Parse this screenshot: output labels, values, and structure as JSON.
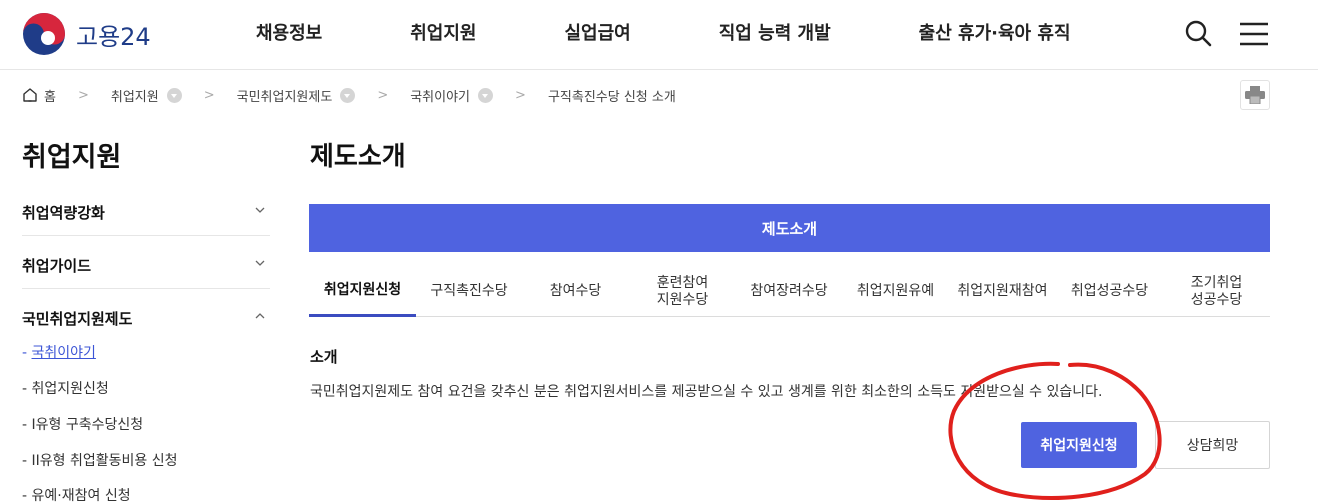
{
  "header": {
    "logo_text": "고용24",
    "nav": [
      "채용정보",
      "취업지원",
      "실업급여",
      "직업 능력 개발",
      "출산 휴가·육아 휴직"
    ]
  },
  "breadcrumb": {
    "home": "홈",
    "items": [
      "취업지원",
      "국민취업지원제도",
      "국취이야기",
      "구직촉진수당 신청 소개"
    ]
  },
  "sidebar": {
    "title": "취업지원",
    "sections": [
      "취업역량강화",
      "취업가이드",
      "국민취업지원제도"
    ],
    "sub_items": [
      {
        "label": "국취이야기",
        "active": true
      },
      {
        "label": "취업지원신청",
        "active": false
      },
      {
        "label": "I유형 구축수당신청",
        "active": false
      },
      {
        "label": "II유형 취업활동비용 신청",
        "active": false
      },
      {
        "label": "유예·재참여 신청",
        "active": false
      }
    ],
    "sub_prefix": "- "
  },
  "main": {
    "title": "제도소개",
    "banner": "제도소개",
    "tabs": [
      {
        "label": "취업지원신청",
        "active": true
      },
      {
        "label": "구직촉진수당",
        "active": false
      },
      {
        "label": "참여수당",
        "active": false
      },
      {
        "label": "훈련참여\n지원수당",
        "active": false
      },
      {
        "label": "참여장려수당",
        "active": false
      },
      {
        "label": "취업지원유예",
        "active": false
      },
      {
        "label": "취업지원재참여",
        "active": false
      },
      {
        "label": "취업성공수당",
        "active": false
      },
      {
        "label": "조기취업\n성공수당",
        "active": false
      }
    ],
    "intro_heading": "소개",
    "intro_text": "국민취업지원제도 참여 요건을 갖추신 분은 취업지원서비스를 제공받으실 수 있고 생계를 위한 최소한의 소득도 지원받으실 수 있습니다.",
    "apply_button": "취업지원신청",
    "consult_button": "상담희망"
  },
  "colors": {
    "primary": "#4f63e0",
    "active_link": "#3c55d6",
    "annotation": "#e0201c",
    "logo_text": "#1f3c88"
  },
  "icons": [
    "search-icon",
    "hamburger-menu-icon",
    "home-icon",
    "printer-icon",
    "chevron-down-icon",
    "chevron-up-icon"
  ]
}
